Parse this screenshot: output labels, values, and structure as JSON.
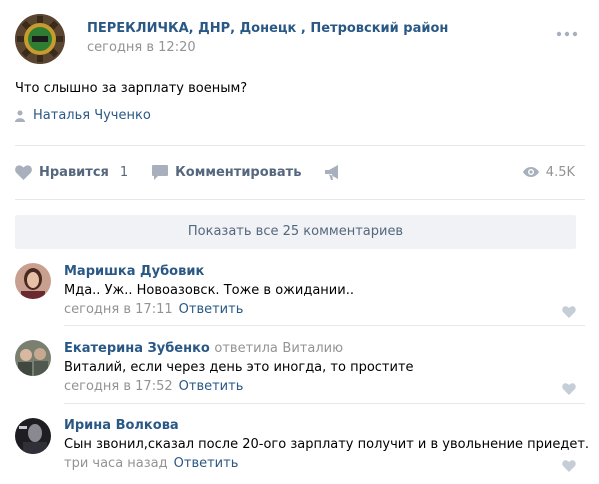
{
  "post": {
    "author": "ПЕРЕКЛИЧКА, ДНР, Донецк , Петровский район",
    "time": "сегодня в 12:20",
    "text": "Что слышно за зарплату военым?",
    "signer": "Наталья Чученко"
  },
  "actions": {
    "like_label": "Нравится",
    "like_count": "1",
    "comment_label": "Комментировать",
    "views": "4.5K"
  },
  "show_all": "Показать все 25 комментариев",
  "comments": [
    {
      "name": "Маришка Дубовик",
      "text": "Мда.. Уж.. Новоазовск. Тоже в ожидании..",
      "time": "сегодня в 17:11",
      "reply": "Ответить"
    },
    {
      "name": "Екатерина Зубенко",
      "replied_word": "ответила",
      "replied_to": "Виталию",
      "text": "Виталий, если через день это иногда, то простите",
      "time": "сегодня в 17:52",
      "reply": "Ответить"
    },
    {
      "name": "Ирина Волкова",
      "text": "Сын звонил,сказал после 20-ого зарплату получит и в увольнение приедет.",
      "time": "три часа назад",
      "reply": "Ответить"
    }
  ],
  "colors": {
    "link": "#2a5885",
    "muted": "#939393",
    "action": "#55677d",
    "icon": "#a7b0bc",
    "button_bg": "#f0f2f5"
  }
}
